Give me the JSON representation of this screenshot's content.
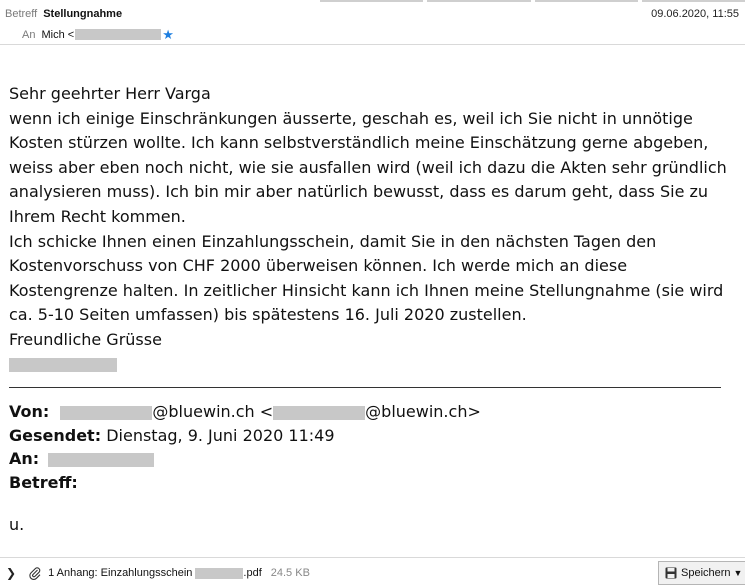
{
  "header": {
    "subject_label": "Betreff",
    "subject": "Stellungnahme",
    "date": "09.06.2020, 11:55",
    "to_label": "An",
    "to_name": "Mich <"
  },
  "body": {
    "greeting": "Sehr geehrter Herr Varga",
    "paragraph1": "wenn ich einige Einschränkungen äusserte, geschah es, weil ich Sie nicht in unnötige Kosten stürzen wollte. Ich kann selbstverständlich meine Einschätzung gerne abgeben, weiss aber eben noch nicht, wie sie ausfallen wird (weil ich dazu die Akten sehr gründlich analysieren muss). Ich bin mir aber natürlich bewusst, dass es darum geht, dass Sie zu Ihrem Recht kommen.",
    "paragraph2": "Ich schicke Ihnen einen Einzahlungsschein, damit Sie in den nächsten Tagen den Kostenvorschuss von CHF 2000 überweisen können. Ich werde mich an diese Kostengrenze halten. In zeitlicher Hinsicht kann ich Ihnen meine Stellungnahme (sie wird ca. 5-10 Seiten umfassen) bis spätestens 16. Juli 2020 zustellen.",
    "closing": "Freundliche Grüsse"
  },
  "quoted": {
    "from_label": "Von:",
    "from_domain1": "@bluewin.ch <",
    "from_domain2": "@bluewin.ch>",
    "sent_label": "Gesendet:",
    "sent_value": "Dienstag, 9. Juni 2020 11:49",
    "to_label": "An:",
    "subject_label": "Betreff:",
    "body": "u."
  },
  "attachment": {
    "label": "1 Anhang: Einzahlungsschein",
    "ext": ".pdf",
    "size": "24.5 KB",
    "save_label": "Speichern"
  },
  "colors": {
    "star": "#1e7fe0",
    "redaction": "#c8c8c8"
  },
  "icons": [
    "star-icon",
    "paperclip-icon",
    "chevron-right-icon",
    "save-disk-icon",
    "dropdown-arrow-icon"
  ]
}
